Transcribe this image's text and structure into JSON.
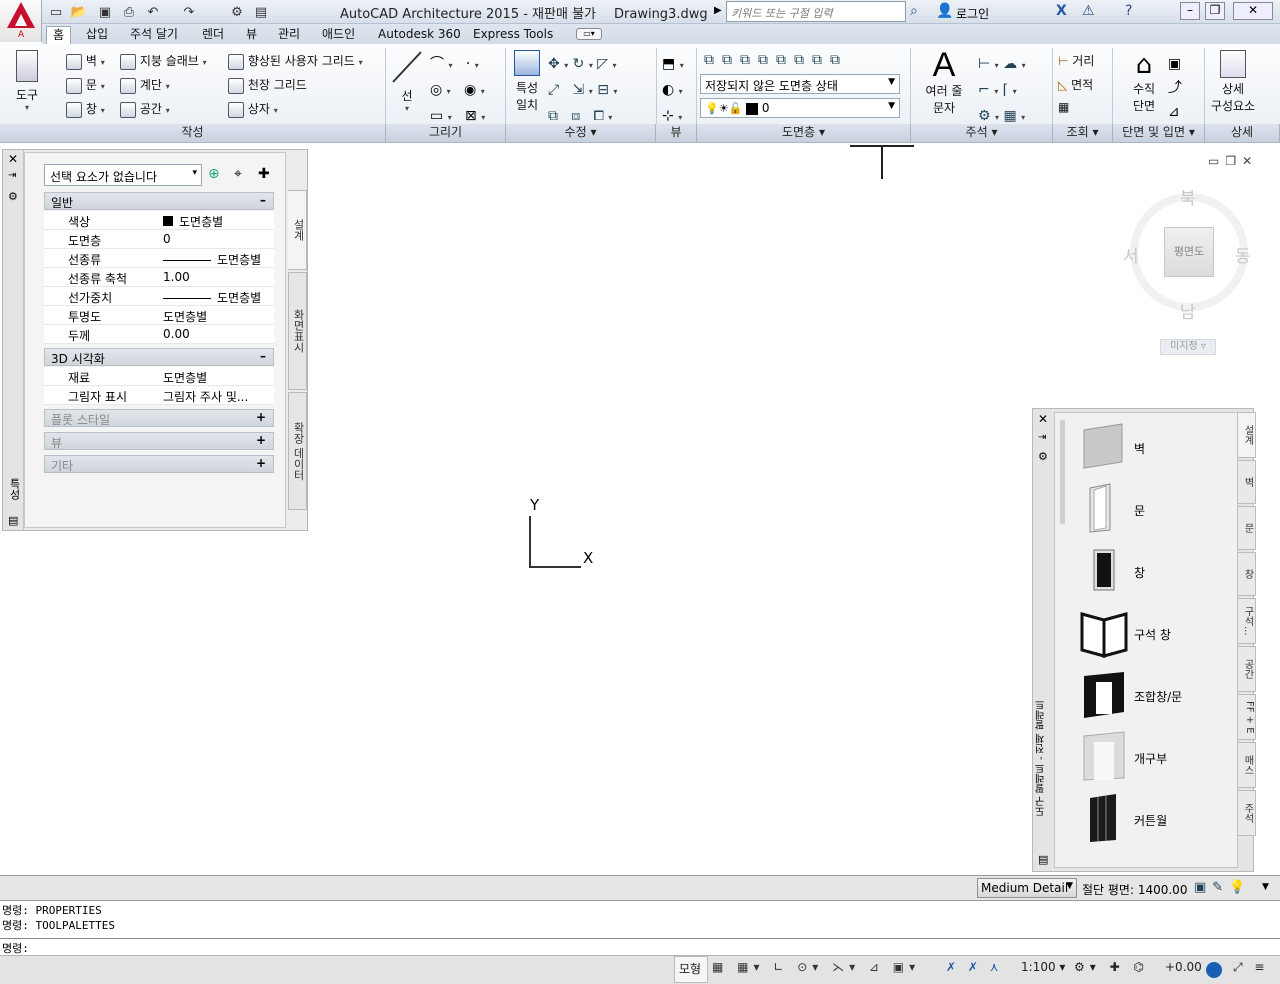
{
  "app": {
    "title": "AutoCAD Architecture 2015 - 재판매 불가",
    "filename": "Drawing3.dwg",
    "app_button_label": "A",
    "search_placeholder": "키워드 또는 구절 입력",
    "login_label": "로그인"
  },
  "tabs": [
    "홈",
    "삽입",
    "주석 달기",
    "렌더",
    "뷰",
    "관리",
    "애드인",
    "Autodesk 360",
    "Express Tools"
  ],
  "ribbon": {
    "door_tool": "도구",
    "build": {
      "wall": "벽",
      "door": "문",
      "window": "창",
      "roof_slab": "지붕 슬래브",
      "stair": "계단",
      "space": "공간",
      "grid": "향상된 사용자 그리드",
      "ceiling_grid": "천장 그리드",
      "box": "상자"
    },
    "line": "선",
    "match_props_line1": "특성",
    "match_props_line2": "일치",
    "layer_state": "저장되지 않은 도면층 상태",
    "layer_current": "0",
    "mtext_line1": "여러 줄",
    "mtext_line2": "문자",
    "distance": "거리",
    "area": "면적",
    "vertical_section_line1": "수직",
    "vertical_section_line2": "단면",
    "detail_comp_line1": "상세",
    "detail_comp_line2": "구성요소",
    "panels": [
      "작성",
      "그리기",
      "수정",
      "뷰",
      "도면층",
      "주석",
      "조회",
      "단면 및 입면",
      "상세"
    ]
  },
  "properties": {
    "selection": "선택 요소가 없습니다",
    "general_header": "일반",
    "general": [
      {
        "name": "색상",
        "value": "도면층별"
      },
      {
        "name": "도면층",
        "value": "0"
      },
      {
        "name": "선종류",
        "value": "도면층별"
      },
      {
        "name": "선종류 축척",
        "value": "1.00"
      },
      {
        "name": "선가중치",
        "value": "도면층별"
      },
      {
        "name": "투명도",
        "value": "도면층별"
      },
      {
        "name": "두께",
        "value": "0.00"
      }
    ],
    "viz_header": "3D 시각화",
    "viz": [
      {
        "name": "재료",
        "value": "도면층별"
      },
      {
        "name": "그림자 표시",
        "value": "그림자 주사 및..."
      }
    ],
    "plot_style": "플롯 스타일",
    "view": "뷰",
    "misc": "기타",
    "side_tabs": [
      "설계",
      "화면표시",
      "확장 데이터"
    ],
    "strip_label": "특성"
  },
  "viewcube": {
    "north": "북",
    "south": "남",
    "east": "동",
    "west": "서",
    "face": "평면도",
    "wcs": "미지정"
  },
  "ucs": {
    "x": "X",
    "y": "Y"
  },
  "toolpalette": {
    "title": "도구 팔레트 - 전체 팔레트",
    "items": [
      "벽",
      "문",
      "창",
      "구석 창",
      "조합창/문",
      "개구부",
      "커튼월"
    ],
    "tabs": [
      "설계",
      "벽",
      "문",
      "창",
      "구석...",
      "공간",
      "FF + E",
      "매스",
      "주석"
    ]
  },
  "status": {
    "detail_level": "Medium Detail",
    "cut_plane": "절단 평면: 1400.00",
    "model": "모형",
    "scale": "1:100",
    "elevation": "+0.00"
  },
  "command": {
    "history": [
      "명령: PROPERTIES",
      "명령: TOOLPALETTES"
    ],
    "prompt": "명령:"
  }
}
